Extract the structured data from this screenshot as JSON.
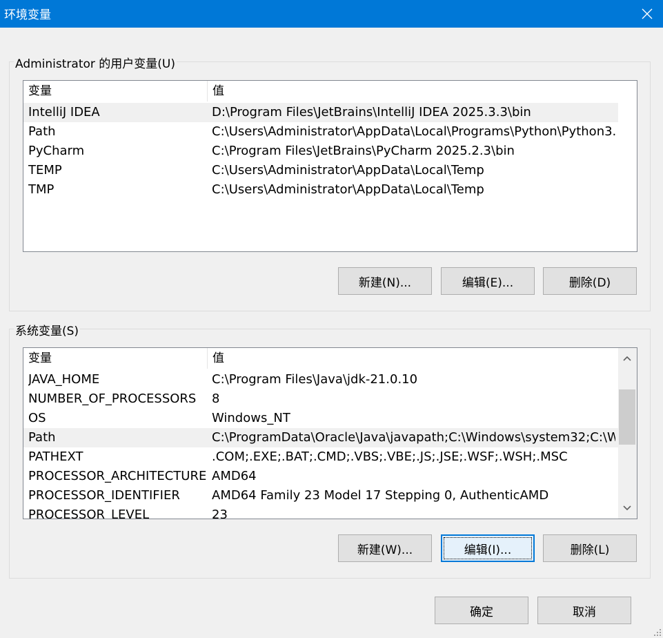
{
  "window": {
    "title": "环境变量",
    "close_icon": "close-icon"
  },
  "user_vars": {
    "label": "Administrator 的用户变量(U)",
    "columns": [
      "变量",
      "值"
    ],
    "rows": [
      {
        "name": "IntelliJ IDEA",
        "value": "D:\\Program Files\\JetBrains\\IntelliJ IDEA 2025.3.3\\bin",
        "selected": true
      },
      {
        "name": "Path",
        "value": "C:\\Users\\Administrator\\AppData\\Local\\Programs\\Python\\Python3...",
        "selected": false
      },
      {
        "name": "PyCharm",
        "value": "C:\\Program Files\\JetBrains\\PyCharm 2025.2.3\\bin",
        "selected": false
      },
      {
        "name": "TEMP",
        "value": "C:\\Users\\Administrator\\AppData\\Local\\Temp",
        "selected": false
      },
      {
        "name": "TMP",
        "value": "C:\\Users\\Administrator\\AppData\\Local\\Temp",
        "selected": false
      }
    ],
    "buttons": {
      "new": "新建(N)...",
      "edit": "编辑(E)...",
      "delete": "删除(D)"
    }
  },
  "system_vars": {
    "label": "系统变量(S)",
    "columns": [
      "变量",
      "值"
    ],
    "rows": [
      {
        "name": "JAVA_HOME",
        "value": "C:\\Program Files\\Java\\jdk-21.0.10",
        "selected": false
      },
      {
        "name": "NUMBER_OF_PROCESSORS",
        "value": "8",
        "selected": false
      },
      {
        "name": "OS",
        "value": "Windows_NT",
        "selected": false
      },
      {
        "name": "Path",
        "value": "C:\\ProgramData\\Oracle\\Java\\javapath;C:\\Windows\\system32;C:\\Wi...",
        "selected": true
      },
      {
        "name": "PATHEXT",
        "value": ".COM;.EXE;.BAT;.CMD;.VBS;.VBE;.JS;.JSE;.WSF;.WSH;.MSC",
        "selected": false
      },
      {
        "name": "PROCESSOR_ARCHITECTURE",
        "value": "AMD64",
        "selected": false
      },
      {
        "name": "PROCESSOR_IDENTIFIER",
        "value": "AMD64 Family 23 Model 17 Stepping 0, AuthenticAMD",
        "selected": false
      },
      {
        "name": "PROCESSOR_LEVEL",
        "value": "23",
        "selected": false
      }
    ],
    "buttons": {
      "new": "新建(W)...",
      "edit": "编辑(I)...",
      "delete": "删除(L)"
    }
  },
  "footer": {
    "ok": "确定",
    "cancel": "取消"
  },
  "colors": {
    "titlebar": "#0078d7",
    "selected_row": "#f0f0f0",
    "focus": "#0078d7"
  }
}
